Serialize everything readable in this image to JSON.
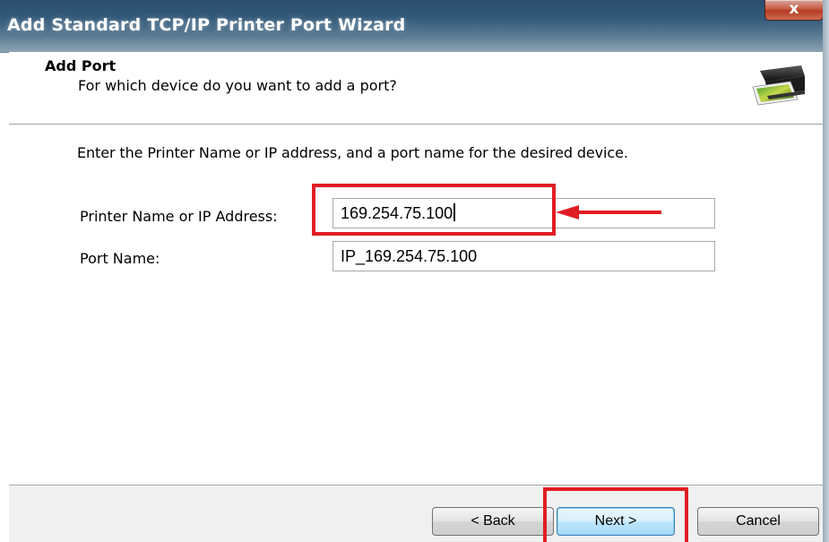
{
  "window": {
    "title": "Add Standard TCP/IP Printer Port Wizard",
    "close_glyph": "x"
  },
  "header": {
    "title": "Add Port",
    "subtitle": "For which device do you want to add a port?",
    "icon": "printer-icon"
  },
  "content": {
    "intro": "Enter the Printer Name or IP address, and a port name for the desired device.",
    "fields": {
      "ip_label": "Printer Name or IP Address:",
      "ip_value": "169.254.75.100",
      "port_label": "Port Name:",
      "port_value": "IP_169.254.75.100"
    }
  },
  "buttons": {
    "back": "< Back",
    "next": "Next >",
    "cancel": "Cancel"
  },
  "colors": {
    "annotation": "#e11d24",
    "titlebar": "#345a7a"
  }
}
